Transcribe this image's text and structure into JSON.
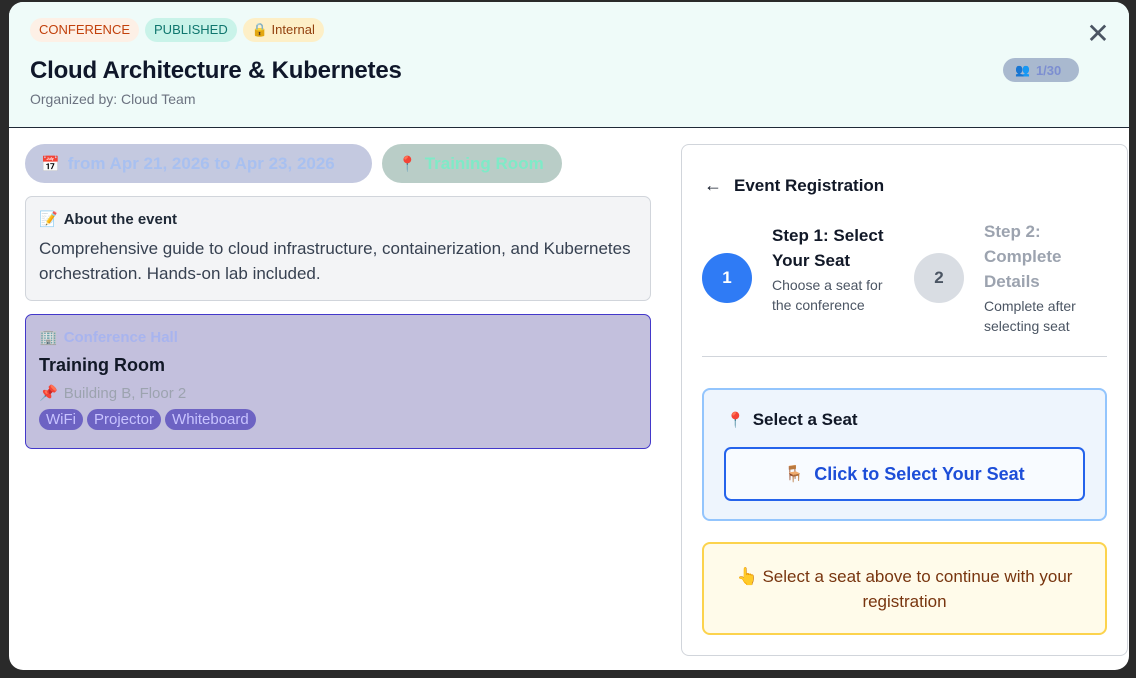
{
  "header": {
    "badges": {
      "type": "CONFERENCE",
      "status": "PUBLISHED",
      "visibility": "Internal"
    },
    "title": "Cloud Architecture & Kubernetes",
    "organizer": "Organized by: Cloud Team",
    "capacity": "1/30",
    "close_glyph": "✕"
  },
  "event": {
    "date_range": "from Apr 21, 2026 to Apr 23, 2026",
    "location": "Training Room",
    "about_title": "About the event",
    "about_text": "Comprehensive guide to cloud infrastructure, containerization, and Kubernetes orchestration. Hands-on lab included."
  },
  "venue": {
    "type": "Conference Hall",
    "name": "Training Room",
    "address": "Building B, Floor 2",
    "amenities": [
      "WiFi",
      "Projector",
      "Whiteboard"
    ]
  },
  "registration": {
    "back_glyph": "←",
    "title": "Event Registration",
    "step1": {
      "number": "1",
      "title": "Step 1: Select Your Seat",
      "desc": "Choose a seat for the conference"
    },
    "step2": {
      "number": "2",
      "title": "Step 2: Complete Details",
      "desc": "Complete after selecting seat"
    },
    "seat_section_title": "Select a Seat",
    "seat_button_label": "Click to Select Your Seat",
    "hint": "Select a seat above to continue with your registration"
  },
  "icons": {
    "lock": "lock-icon",
    "users": "users-icon",
    "calendar": "calendar-icon",
    "pin": "pin-icon",
    "memo": "memo-icon",
    "building": "building-icon",
    "pushpin": "pushpin-icon",
    "chair": "chair-icon",
    "pointer": "pointing-hand-icon"
  },
  "colors": {
    "primary": "#2f7bf5",
    "header_bg": "#effbf9",
    "venue_border": "#4338ca",
    "hint_border": "#fcd34d"
  }
}
